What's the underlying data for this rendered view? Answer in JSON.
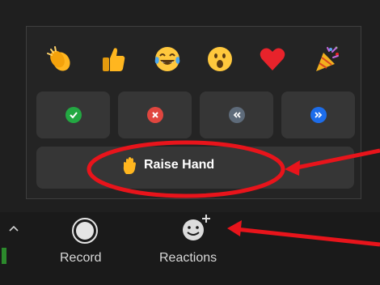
{
  "panel": {
    "emojis": [
      {
        "icon": "clapping-hands-icon"
      },
      {
        "icon": "thumbs-up-icon"
      },
      {
        "icon": "tears-of-joy-icon"
      },
      {
        "icon": "open-mouth-icon"
      },
      {
        "icon": "heart-icon"
      },
      {
        "icon": "party-popper-icon"
      }
    ],
    "reactions": [
      {
        "icon": "check-icon",
        "color": "#23a842"
      },
      {
        "icon": "cross-icon",
        "color": "#e0463f"
      },
      {
        "icon": "slower-icon",
        "color": "#5e6b7a"
      },
      {
        "icon": "faster-icon",
        "color": "#1d6dea"
      }
    ],
    "raise_hand": {
      "label": "Raise Hand",
      "icon": "raised-hand-icon"
    }
  },
  "toolbar": {
    "record": {
      "label": "Record",
      "icon": "record-icon"
    },
    "reactions": {
      "label": "Reactions",
      "icon": "reactions-icon"
    },
    "chevron": {
      "icon": "chevron-up-icon"
    }
  },
  "annotations": {
    "color": "#e8141b"
  }
}
